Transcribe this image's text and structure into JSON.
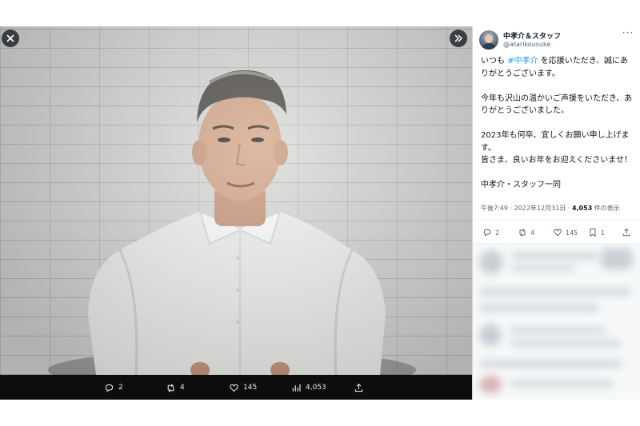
{
  "media": {
    "actions": {
      "replies": "2",
      "reposts": "4",
      "likes": "145",
      "views": "4,053"
    }
  },
  "author": {
    "display_name": "中孝介＆スタッフ",
    "handle": "@atarikousuke"
  },
  "tweet": {
    "line1_prefix": "いつも ",
    "hashtag": "#中孝介",
    "line1_suffix": " を応援いただき、誠にありがとうございます。",
    "para2": "今年も沢山の温かいご声援をいただき、ありがとうございました。",
    "para3_a": "2023年も何卒、宜しくお願い申し上げます。",
    "para3_b": "皆さま、良いお年をお迎えくださいませ！",
    "para4": "中孝介・スタッフ一同"
  },
  "meta": {
    "time": "午後7:49 · 2022年12月31日 · ",
    "views_count": "4,053",
    "views_label": " 件の表示"
  },
  "stats": {
    "replies": "2",
    "reposts": "4",
    "likes": "145",
    "bookmarks": "1"
  },
  "colors": {
    "accent": "#1d9bf0",
    "text": "#0f1419",
    "muted": "#536471"
  }
}
